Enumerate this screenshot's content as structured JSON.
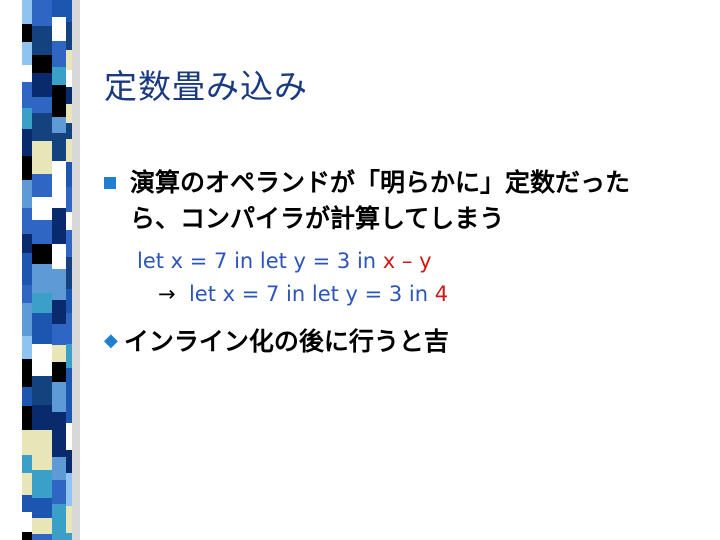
{
  "slide": {
    "title": "定数畳み込み",
    "bullets": [
      {
        "icon": "square-bullet-icon",
        "lines": [
          "演算のオペランドが「明らかに」定数だった",
          "ら、コンパイラが計算してしまう"
        ]
      },
      {
        "icon": "diamond-bullet-icon",
        "text": "インライン化の後に行うと吉"
      }
    ],
    "code": {
      "line1_prefix": "let x = 7 in let y = 3 in ",
      "line1_x": "x",
      "line1_minus": " – ",
      "line1_y": "y",
      "line2_arrow": "→",
      "line2_prefix": "  let x = 7 in let y = 3 in ",
      "line2_result": "4"
    }
  },
  "colors": {
    "title": "#1a3a80",
    "bullet": "#1e7fd1",
    "code": "#2b55b8",
    "highlight": "#d01818"
  }
}
